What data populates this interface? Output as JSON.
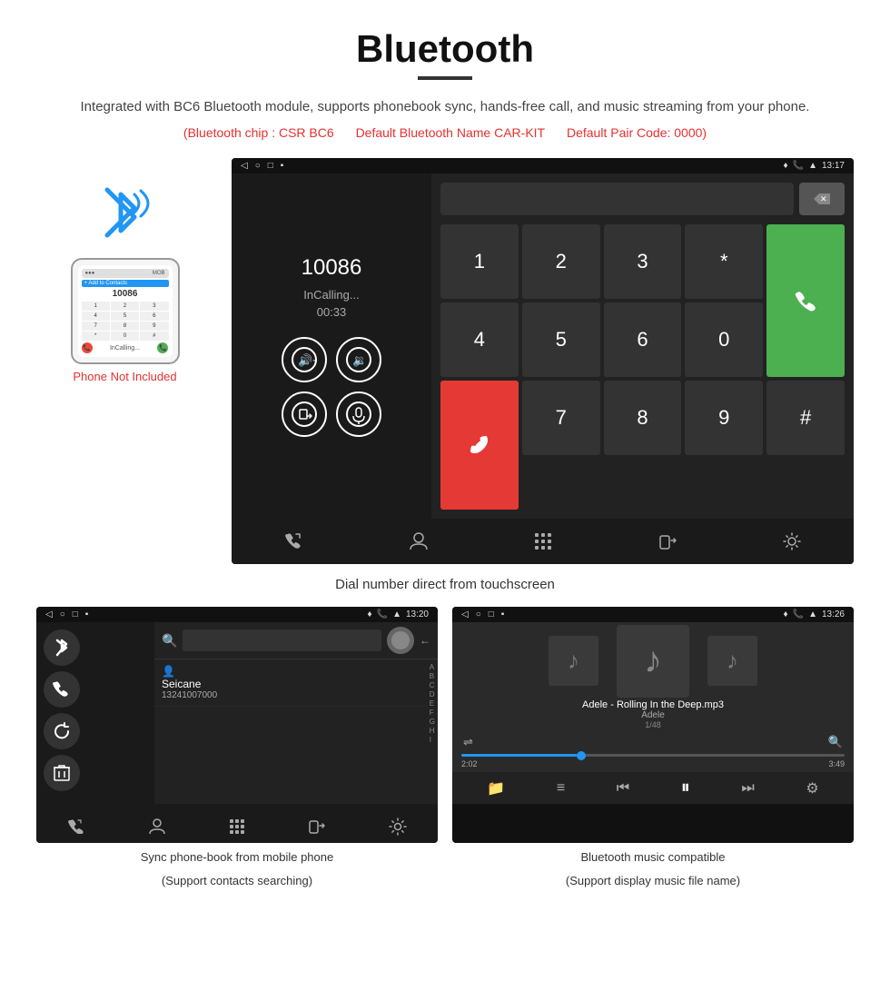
{
  "page": {
    "title": "Bluetooth",
    "description": "Integrated with BC6 Bluetooth module, supports phonebook sync, hands-free call, and music streaming from your phone.",
    "specs": {
      "chip": "(Bluetooth chip : CSR BC6",
      "name": "Default Bluetooth Name CAR-KIT",
      "code": "Default Pair Code: 0000)"
    }
  },
  "phone_side": {
    "not_included": "Phone Not Included"
  },
  "call_screen": {
    "status_bar": {
      "time": "13:17",
      "icons_left": [
        "◁",
        "○",
        "□",
        "▪"
      ]
    },
    "number": "10086",
    "status": "InCalling...",
    "timer": "00:33",
    "dialpad": [
      "1",
      "2",
      "3",
      "*",
      "4",
      "5",
      "6",
      "0",
      "7",
      "8",
      "9",
      "#"
    ]
  },
  "main_caption": "Dial number direct from touchscreen",
  "phonebook_screen": {
    "status_bar": {
      "time": "13:20"
    },
    "contact_name": "Seicane",
    "contact_number": "13241007000"
  },
  "music_screen": {
    "status_bar": {
      "time": "13:26"
    },
    "song": "Adele - Rolling In the Deep.mp3",
    "artist": "Adele",
    "track": "1/48",
    "time_current": "2:02",
    "time_total": "3:49"
  },
  "bottom_captions": {
    "left_main": "Sync phone-book from mobile phone",
    "left_sub": "(Support contacts searching)",
    "right_main": "Bluetooth music compatible",
    "right_sub": "(Support display music file name)"
  },
  "nav_icons": {
    "call": "📞",
    "contact": "👤",
    "dialpad": "⠿",
    "transfer": "↗",
    "settings": "⚙"
  }
}
